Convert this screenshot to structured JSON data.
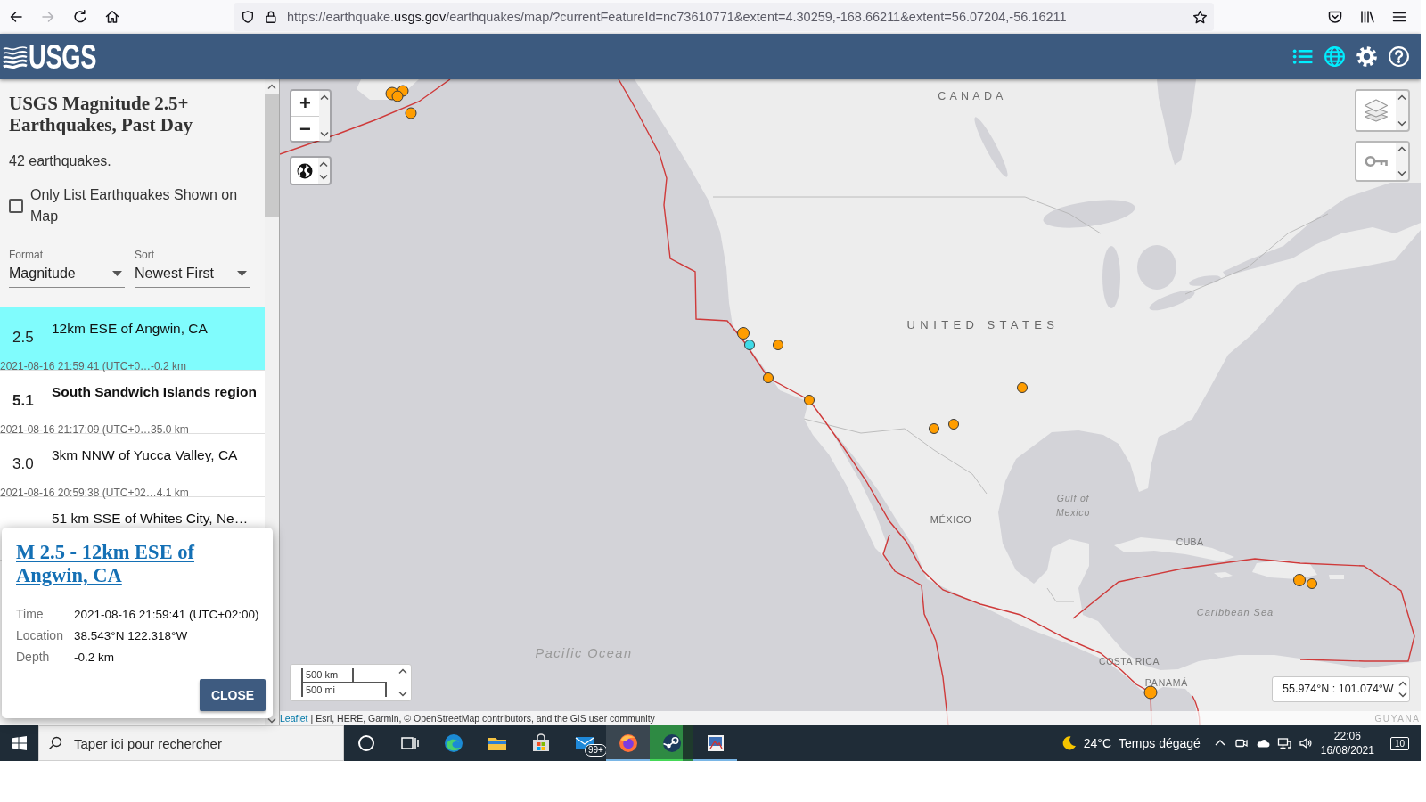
{
  "browser": {
    "nav_buttons": [
      {
        "kind": "back",
        "disabled": false
      },
      {
        "kind": "forward",
        "disabled": true
      },
      {
        "kind": "reload",
        "disabled": false
      },
      {
        "kind": "home",
        "disabled": false
      }
    ],
    "url": "https://earthquake.**usgs.gov**/earthquakes/map/?currentFeatureId=nc73610771&extent=4.30259,-168.66211&extent=56.07204,-56.16211",
    "tools": [
      {
        "kind": "pocket"
      },
      {
        "kind": "library"
      },
      {
        "kind": "menu"
      }
    ]
  },
  "header": {
    "logo": "USGS",
    "tools": [
      {
        "kind": "list",
        "selected": true
      },
      {
        "kind": "globe",
        "selected": true
      },
      {
        "kind": "settings",
        "selected": false
      },
      {
        "kind": "help",
        "selected": false
      }
    ]
  },
  "panel": {
    "title": "USGS Magnitude 2.5+ Earthquakes, Past Day",
    "count": "42 earthquakes.",
    "filter": {
      "label": "Only List Earthquakes Shown on Map",
      "checked": false
    },
    "format": {
      "label": "Format",
      "value": "Magnitude"
    },
    "sort": {
      "label": "Sort",
      "value": "Newest First"
    },
    "earthquakes": [
      {
        "magnitude": "2.5",
        "place": "12km ESE of Angwin, CA",
        "time": "2021-08-16 21:59:41 (UTC+0…",
        "depth": "-0.2 km",
        "selected": true,
        "emphasized": false
      },
      {
        "magnitude": "5.1",
        "place": "South Sandwich Islands region",
        "time": "2021-08-16 21:17:09 (UTC+0…",
        "depth": "35.0 km",
        "selected": false,
        "emphasized": true
      },
      {
        "magnitude": "3.0",
        "place": "3km NNW of Yucca Valley, CA",
        "time": "2021-08-16 20:59:38 (UTC+02…",
        "depth": "4.1 km",
        "selected": false,
        "emphasized": false
      },
      {
        "place": "51 km SSE of Whites City, Ne…",
        "selected": false,
        "emphasized": false
      }
    ]
  },
  "popup": {
    "title": "M 2.5 - 12km ESE of Angwin, CA",
    "details": [
      {
        "label": "Time",
        "value": "2021-08-16 21:59:41 (UTC+02:00)"
      },
      {
        "label": "Location",
        "value": "38.543°N 122.318°W"
      },
      {
        "label": "Depth",
        "value": "-0.2 km"
      }
    ],
    "button": "CLOSE"
  },
  "map": {
    "zoom_in": "+",
    "zoom_out": "−",
    "labels": [
      {
        "text": "CANADA",
        "kind": "country"
      },
      {
        "text": "UNITED STATES",
        "kind": "country"
      },
      {
        "text": "MÉXICO",
        "kind": "country"
      },
      {
        "text": "Gulf of Mexico",
        "kind": "sea"
      },
      {
        "text": "CUBA",
        "kind": "country"
      },
      {
        "text": "Caribbean Sea",
        "kind": "sea"
      },
      {
        "text": "Pacific Ocean",
        "kind": "ocean"
      },
      {
        "text": "COSTA RICA",
        "kind": "country"
      },
      {
        "text": "PANAMÁ",
        "kind": "country"
      },
      {
        "text": "GUYANA",
        "kind": "country"
      }
    ],
    "markers": [
      {
        "selected": false
      },
      {
        "selected": false
      },
      {
        "selected": false
      },
      {
        "selected": false
      },
      {
        "selected": false
      },
      {
        "selected": true
      },
      {
        "selected": false
      },
      {
        "selected": false
      },
      {
        "selected": false
      },
      {
        "selected": false
      },
      {
        "selected": false
      },
      {
        "selected": false
      },
      {
        "selected": false
      },
      {
        "selected": false
      },
      {
        "selected": false
      }
    ],
    "scale": [
      "500 km",
      "500 mi"
    ],
    "coordinates": "55.974°N : 101.074°W",
    "attribution": {
      "link": "Leaflet",
      "text": "| Esri, HERE, Garmin, © OpenStreetMap contributors, and the GIS user community"
    }
  },
  "taskbar": {
    "search": {
      "placeholder": "Taper ici pour rechercher"
    },
    "apps": [
      {
        "kind": "cortana",
        "running": false,
        "active": false
      },
      {
        "kind": "task_view",
        "running": false,
        "active": false
      },
      {
        "kind": "edge",
        "running": false,
        "active": false
      },
      {
        "kind": "explorer",
        "running": false,
        "active": false
      },
      {
        "kind": "store",
        "running": false,
        "active": false
      },
      {
        "kind": "mail",
        "badge": "99+",
        "running": false,
        "active": false
      },
      {
        "kind": "firefox",
        "running": true,
        "active": true
      },
      {
        "kind": "steam",
        "running": true,
        "active": false,
        "level": 0.75
      },
      {
        "kind": "app",
        "running": true,
        "active": false
      }
    ],
    "weather": {
      "temperature": "24°C",
      "condition": "Temps dégagé"
    },
    "tray": [
      {
        "kind": "chevron"
      },
      {
        "kind": "meet"
      },
      {
        "kind": "cloud"
      },
      {
        "kind": "network"
      },
      {
        "kind": "volume"
      }
    ],
    "clock": {
      "time": "22:06",
      "date": "16/08/2021"
    },
    "notifications": "10"
  }
}
